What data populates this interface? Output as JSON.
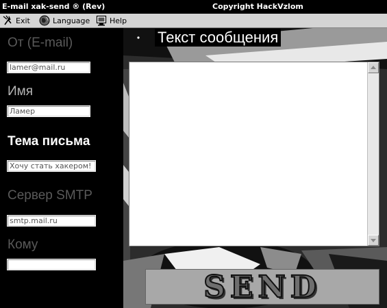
{
  "window": {
    "title": "E-mail xak-send ® (Rev)",
    "copyright": "Copyright HackVzlom"
  },
  "menu": {
    "items": [
      {
        "label": "Exit",
        "icon": "exit-icon"
      },
      {
        "label": "Language",
        "icon": "globe-icon"
      },
      {
        "label": "Help",
        "icon": "help-monitor-icon"
      }
    ]
  },
  "form": {
    "from_label": "От (E-mail)",
    "from_value": "lamer@mail.ru",
    "name_label": "Имя",
    "name_value": "Ламер",
    "subject_label": "Тема письма",
    "subject_value": "Хочу стать хакером!",
    "smtp_label": "Сервер SMTP",
    "smtp_value": "smtp.mail.ru",
    "to_label": "Кому",
    "to_value": ""
  },
  "message": {
    "title": "Текст сообщения",
    "body": ""
  },
  "send": {
    "label": "SEND"
  },
  "colors": {
    "background": "#000000",
    "menubar": "#d4d4d4",
    "label_dim": "#5a5a5a",
    "label_bright": "#ffffff"
  }
}
